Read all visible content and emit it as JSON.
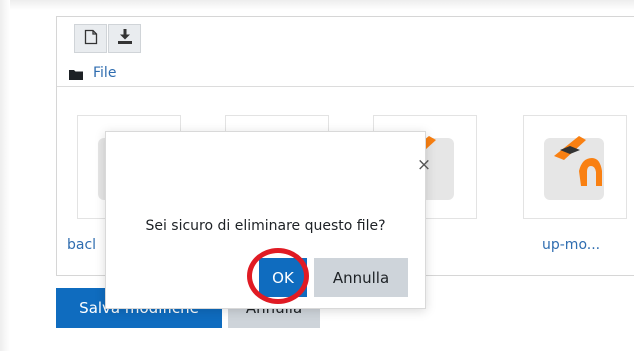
{
  "toolbar": {
    "new_file_icon": "file-icon",
    "download_icon": "download-icon"
  },
  "path": {
    "folder_icon": "folder-icon",
    "label": "File"
  },
  "files": [
    {
      "name": "bacl",
      "icon": "moodle-backup-icon"
    },
    {
      "name": "",
      "icon": "moodle-backup-icon"
    },
    {
      "name": "",
      "icon": "moodle-backup-icon"
    },
    {
      "name": "up-mo...",
      "icon": "moodle-backup-icon"
    }
  ],
  "form": {
    "save_label": "Salva modifiche",
    "cancel_label": "Annulla"
  },
  "dialog": {
    "close_symbol": "×",
    "message": "Sei sicuro di eliminare questo file?",
    "ok_label": "OK",
    "cancel_label": "Annulla"
  },
  "colors": {
    "primary": "#0f6cbf",
    "secondary": "#ced4da",
    "link": "#2f6db0",
    "highlight": "#e01b24",
    "moodle_orange": "#f98012"
  }
}
